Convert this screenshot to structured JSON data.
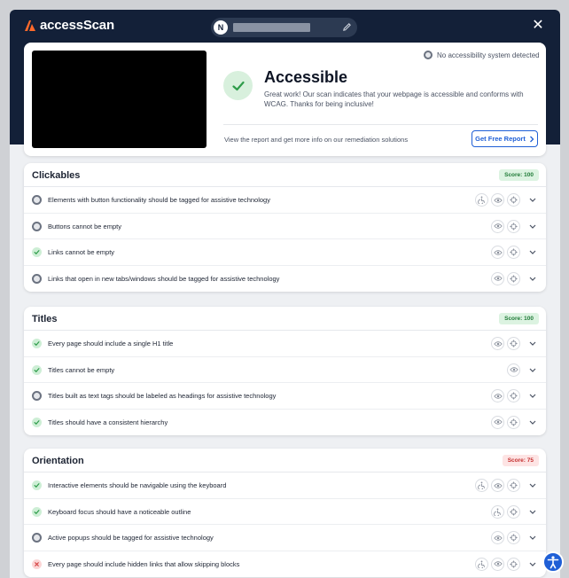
{
  "brand": {
    "name": "accessScan"
  },
  "url_bar": {
    "avatar_letter": "N",
    "url": "redacted"
  },
  "summary": {
    "status_line": "No accessibility system detected",
    "title": "Accessible",
    "description": "Great work! Our scan indicates that your webpage is accessible and conforms with WCAG. Thanks for being inclusive!",
    "report_text": "View the report and get more info on our remediation solutions",
    "report_button": "Get Free Report"
  },
  "colors": {
    "header": "#132038",
    "accent": "#1f5fd6",
    "pass": "#2e9c4a",
    "fail": "#d64545"
  },
  "sections": [
    {
      "title": "Clickables",
      "score": "Score: 100",
      "rows": [
        {
          "label": "Elements with button functionality should be tagged for assistive technology",
          "status": "pending",
          "icons": [
            "wheelchair-icon",
            "eye-icon",
            "target-icon"
          ]
        },
        {
          "label": "Buttons cannot be empty",
          "status": "pending",
          "icons": [
            "eye-icon",
            "target-icon"
          ]
        },
        {
          "label": "Links cannot be empty",
          "status": "pass",
          "icons": [
            "eye-icon",
            "target-icon"
          ]
        },
        {
          "label": "Links that open in new tabs/windows should be tagged for assistive technology",
          "status": "pending",
          "icons": [
            "eye-icon",
            "target-icon"
          ]
        }
      ]
    },
    {
      "title": "Titles",
      "score": "Score: 100",
      "rows": [
        {
          "label": "Every page should include a single H1 title",
          "status": "pass",
          "icons": [
            "eye-icon",
            "target-icon"
          ]
        },
        {
          "label": "Titles cannot be empty",
          "status": "pass",
          "icons": [
            "eye-icon"
          ]
        },
        {
          "label": "Titles built as text tags should be labeled as headings for assistive technology",
          "status": "pending",
          "icons": [
            "eye-icon",
            "target-icon"
          ]
        },
        {
          "label": "Titles should have a consistent hierarchy",
          "status": "pass",
          "icons": [
            "eye-icon",
            "target-icon"
          ]
        }
      ]
    },
    {
      "title": "Orientation",
      "score": "Score: 75",
      "rows": [
        {
          "label": "Interactive elements should be navigable using the keyboard",
          "status": "pass",
          "icons": [
            "wheelchair-icon",
            "eye-icon",
            "target-icon"
          ]
        },
        {
          "label": "Keyboard focus should have a noticeable outline",
          "status": "pass",
          "icons": [
            "wheelchair-icon",
            "target-icon"
          ]
        },
        {
          "label": "Active popups should be tagged for assistive technology",
          "status": "pending",
          "icons": [
            "eye-icon",
            "target-icon"
          ]
        },
        {
          "label": "Every page should include hidden links that allow skipping blocks",
          "status": "fail",
          "icons": [
            "wheelchair-icon",
            "eye-icon",
            "target-icon"
          ]
        }
      ]
    }
  ]
}
